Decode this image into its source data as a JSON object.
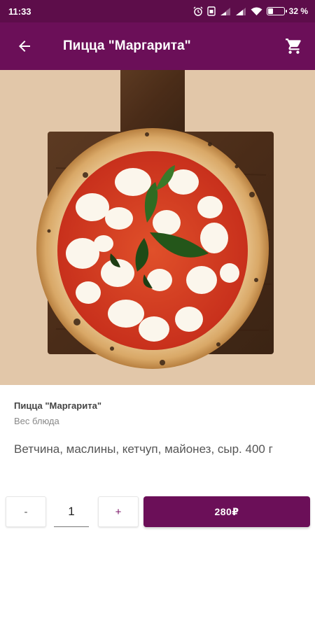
{
  "status_bar": {
    "time": "11:33",
    "battery_text": "32 %",
    "battery_level": 0.32
  },
  "app_bar": {
    "title": "Пицца \"Маргарита\"",
    "back_icon": "arrow-back-icon",
    "cart_icon": "shopping-cart-icon"
  },
  "hero": {
    "image": "margherita-pizza-on-wooden-board-photo"
  },
  "details": {
    "name": "Пицца \"Маргарита\"",
    "weight_label": "Вес блюда",
    "description": "Ветчина, маслины, кетчуп, майонез, сыр. 400 г"
  },
  "controls": {
    "minus_label": "-",
    "quantity": "1",
    "plus_label": "+",
    "price_label": "280₽"
  },
  "colors": {
    "status_bar": "#5d0d4a",
    "primary": "#6b0f58",
    "background": "#ffffff",
    "photo_background": "#e2c7a9"
  }
}
